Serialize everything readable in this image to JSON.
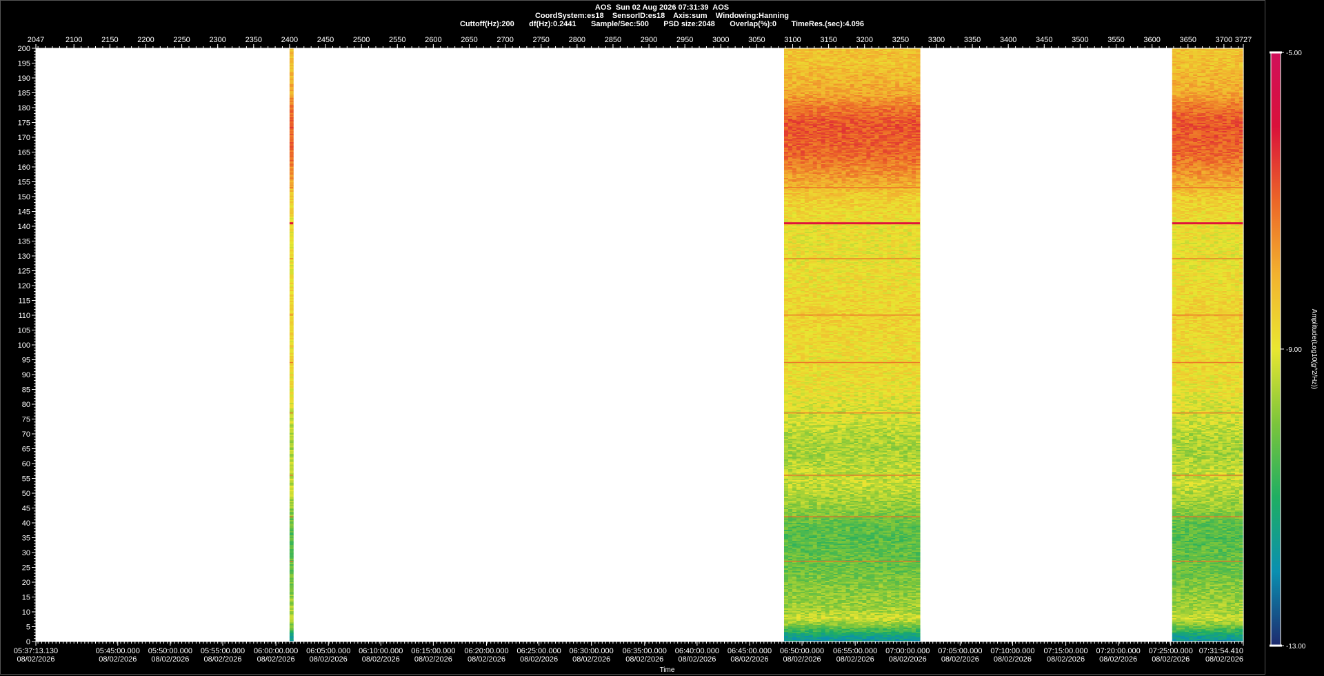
{
  "header": {
    "line1": "AOS  Sun 02 Aug 2026 07:31:39  AOS",
    "line2": "CoordSystem:es18    SensorID:es18    Axis:sum    Windowing:Hanning",
    "line3": "Cuttoff(Hz):200       df(Hz):0.2441       Sample/Sec:500       PSD size:2048       Overlap(%):0       TimeRes.(sec):4.096"
  },
  "colors": {
    "background": "#000000",
    "plot_area": "#ffffff",
    "colormap": [
      "#1e2a6e",
      "#0a8fb0",
      "#1fae62",
      "#7cc53b",
      "#e9e631",
      "#f2b22f",
      "#ec6628",
      "#d9113a",
      "#d0105a"
    ]
  },
  "chart_data": {
    "type": "heatmap",
    "top_axis": {
      "label": "",
      "range": [
        2047,
        3727
      ],
      "ticks": [
        "2047",
        "2100",
        "2150",
        "2200",
        "2250",
        "2300",
        "2350",
        "2400",
        "2450",
        "2500",
        "2550",
        "2600",
        "2650",
        "2700",
        "2750",
        "2800",
        "2850",
        "2900",
        "2950",
        "3000",
        "3050",
        "3100",
        "3150",
        "3200",
        "3250",
        "3300",
        "3350",
        "3400",
        "3450",
        "3500",
        "3550",
        "3600",
        "3650",
        "3700",
        "3727"
      ]
    },
    "y_axis": {
      "label": "",
      "range": [
        0,
        200
      ],
      "ticks": [
        "200",
        "195",
        "190",
        "185",
        "180",
        "175",
        "170",
        "165",
        "160",
        "155",
        "150",
        "145",
        "140",
        "135",
        "130",
        "125",
        "120",
        "115",
        "110",
        "105",
        "100",
        "95",
        "90",
        "85",
        "80",
        "75",
        "70",
        "65",
        "60",
        "55",
        "50",
        "45",
        "40",
        "35",
        "30",
        "25",
        "20",
        "15",
        "10",
        "5",
        "0"
      ]
    },
    "x_axis": {
      "label": "Time",
      "range": [
        "05:37:13.130",
        "07:31:54.410"
      ],
      "ticks": [
        {
          "time": "05:37:13.130",
          "date": "08/02/2026",
          "frame": 2047
        },
        {
          "time": "05:45:00.000",
          "date": "08/02/2026",
          "frame": 2161
        },
        {
          "time": "05:50:00.000",
          "date": "08/02/2026",
          "frame": 2234
        },
        {
          "time": "05:55:00.000",
          "date": "08/02/2026",
          "frame": 2307
        },
        {
          "time": "06:00:00.000",
          "date": "08/02/2026",
          "frame": 2381
        },
        {
          "time": "06:05:00.000",
          "date": "08/02/2026",
          "frame": 2454
        },
        {
          "time": "06:10:00.000",
          "date": "08/02/2026",
          "frame": 2527
        },
        {
          "time": "06:15:00.000",
          "date": "08/02/2026",
          "frame": 2600
        },
        {
          "time": "06:20:00.000",
          "date": "08/02/2026",
          "frame": 2674
        },
        {
          "time": "06:25:00.000",
          "date": "08/02/2026",
          "frame": 2747
        },
        {
          "time": "06:30:00.000",
          "date": "08/02/2026",
          "frame": 2820
        },
        {
          "time": "06:35:00.000",
          "date": "08/02/2026",
          "frame": 2894
        },
        {
          "time": "06:40:00.000",
          "date": "08/02/2026",
          "frame": 2967
        },
        {
          "time": "06:45:00.000",
          "date": "08/02/2026",
          "frame": 3040
        },
        {
          "time": "06:50:00.000",
          "date": "08/02/2026",
          "frame": 3113
        },
        {
          "time": "06:55:00.000",
          "date": "08/02/2026",
          "frame": 3187
        },
        {
          "time": "07:00:00.000",
          "date": "08/02/2026",
          "frame": 3260
        },
        {
          "time": "07:05:00.000",
          "date": "08/02/2026",
          "frame": 3333
        },
        {
          "time": "07:10:00.000",
          "date": "08/02/2026",
          "frame": 3406
        },
        {
          "time": "07:15:00.000",
          "date": "08/02/2026",
          "frame": 3480
        },
        {
          "time": "07:20:00.000",
          "date": "08/02/2026",
          "frame": 3553
        },
        {
          "time": "07:25:00.000",
          "date": "08/02/2026",
          "frame": 3626
        },
        {
          "time": "07:31:54.410",
          "date": "08/02/2026",
          "frame": 3727
        }
      ]
    },
    "colorbar": {
      "label": "Amplitude(Log10(g^2/Hz))",
      "range": [
        -13.0,
        -5.0
      ],
      "ticks": [
        "-5.00",
        "-9.00",
        "-13.00"
      ]
    },
    "data_segments": [
      {
        "frame_start": 2400,
        "frame_end": 2405
      },
      {
        "frame_start": 3088,
        "frame_end": 3277
      },
      {
        "frame_start": 3628,
        "frame_end": 3727
      }
    ],
    "frequency_profile": {
      "freq_hz": [
        0,
        2,
        5,
        8,
        10,
        15,
        20,
        25,
        30,
        35,
        40,
        45,
        50,
        55,
        60,
        65,
        70,
        75,
        80,
        85,
        90,
        100,
        110,
        120,
        130,
        140,
        150,
        155,
        160,
        165,
        170,
        175,
        180,
        185,
        190,
        195,
        200
      ],
      "amplitude_log10": [
        -11.8,
        -11.5,
        -10.2,
        -9.2,
        -9.6,
        -9.8,
        -10.0,
        -10.2,
        -10.3,
        -10.4,
        -10.3,
        -9.8,
        -9.5,
        -9.3,
        -9.5,
        -9.6,
        -9.5,
        -9.2,
        -9.1,
        -8.9,
        -8.8,
        -8.8,
        -8.6,
        -8.8,
        -8.9,
        -8.9,
        -8.5,
        -7.9,
        -7.4,
        -7.0,
        -6.9,
        -6.8,
        -7.2,
        -7.9,
        -8.1,
        -8.3,
        -8.3
      ]
    },
    "tonal_lines_hz": [
      141,
      94,
      77,
      56,
      42,
      27,
      153,
      110,
      129
    ],
    "grid": false
  }
}
